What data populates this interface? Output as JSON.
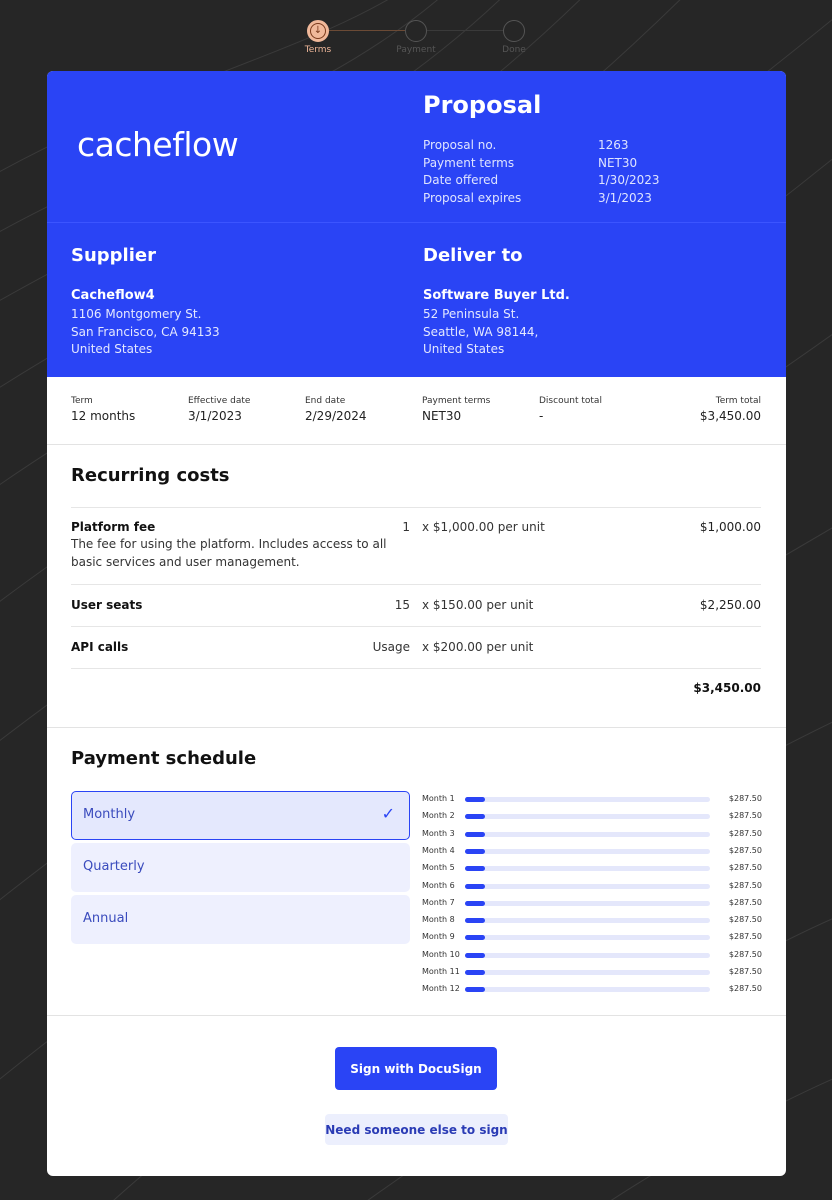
{
  "stepper": {
    "steps": [
      {
        "label": "Terms"
      },
      {
        "label": "Payment"
      },
      {
        "label": "Done"
      }
    ]
  },
  "brand": {
    "logo_text": "cacheflow"
  },
  "proposal": {
    "title": "Proposal",
    "meta": [
      {
        "key": "Proposal no.",
        "value": "1263"
      },
      {
        "key": "Payment terms",
        "value": "NET30"
      },
      {
        "key": "Date offered",
        "value": "1/30/2023"
      },
      {
        "key": "Proposal expires",
        "value": "3/1/2023"
      }
    ]
  },
  "supplier": {
    "heading": "Supplier",
    "name": "Cacheflow4",
    "lines": [
      "1106 Montgomery St.",
      "San Francisco, CA 94133",
      "United States"
    ]
  },
  "deliver_to": {
    "heading": "Deliver to",
    "name": "Software Buyer Ltd.",
    "lines": [
      "52 Peninsula St.",
      "Seattle, WA 98144,",
      "United States"
    ]
  },
  "terms": [
    {
      "label": "Term",
      "value": "12 months"
    },
    {
      "label": "Effective date",
      "value": "3/1/2023"
    },
    {
      "label": "End date",
      "value": "2/29/2024"
    },
    {
      "label": "Payment terms",
      "value": "NET30"
    },
    {
      "label": "Discount total",
      "value": "-"
    },
    {
      "label": "Term total",
      "value": "$3,450.00"
    }
  ],
  "recurring": {
    "title": "Recurring costs",
    "items": [
      {
        "name": "Platform fee",
        "description": "The fee for using the platform. Includes access to all basic services and user management.",
        "qty": "1",
        "price": "x $1,000.00 per unit",
        "total": "$1,000.00"
      },
      {
        "name": "User seats",
        "description": "",
        "qty": "15",
        "price": "x $150.00 per unit",
        "total": "$2,250.00"
      },
      {
        "name": "API calls",
        "description": "",
        "qty": "Usage",
        "price": "x $200.00 per unit",
        "total": ""
      }
    ],
    "grand_total": "$3,450.00"
  },
  "schedule": {
    "title": "Payment schedule",
    "options": [
      "Monthly",
      "Quarterly",
      "Annual"
    ],
    "selected": "Monthly",
    "months": [
      {
        "label": "Month 1",
        "amount": "$287.50",
        "fraction": 0.083
      },
      {
        "label": "Month 2",
        "amount": "$287.50",
        "fraction": 0.083
      },
      {
        "label": "Month 3",
        "amount": "$287.50",
        "fraction": 0.083
      },
      {
        "label": "Month 4",
        "amount": "$287.50",
        "fraction": 0.083
      },
      {
        "label": "Month 5",
        "amount": "$287.50",
        "fraction": 0.083
      },
      {
        "label": "Month 6",
        "amount": "$287.50",
        "fraction": 0.083
      },
      {
        "label": "Month 7",
        "amount": "$287.50",
        "fraction": 0.083
      },
      {
        "label": "Month 8",
        "amount": "$287.50",
        "fraction": 0.083
      },
      {
        "label": "Month 9",
        "amount": "$287.50",
        "fraction": 0.083
      },
      {
        "label": "Month 10",
        "amount": "$287.50",
        "fraction": 0.083
      },
      {
        "label": "Month 11",
        "amount": "$287.50",
        "fraction": 0.083
      },
      {
        "label": "Month 12",
        "amount": "$287.50",
        "fraction": 0.083
      }
    ]
  },
  "actions": {
    "primary_label": "Sign with DocuSign",
    "secondary_label": "Need someone else to sign"
  },
  "colors": {
    "brand_blue": "#2a44f5",
    "background": "#262626",
    "active_step": "#f0b89a"
  },
  "icons": {
    "active_step": "arrow-down-circle-icon",
    "selected_option": "checkmark-icon"
  }
}
